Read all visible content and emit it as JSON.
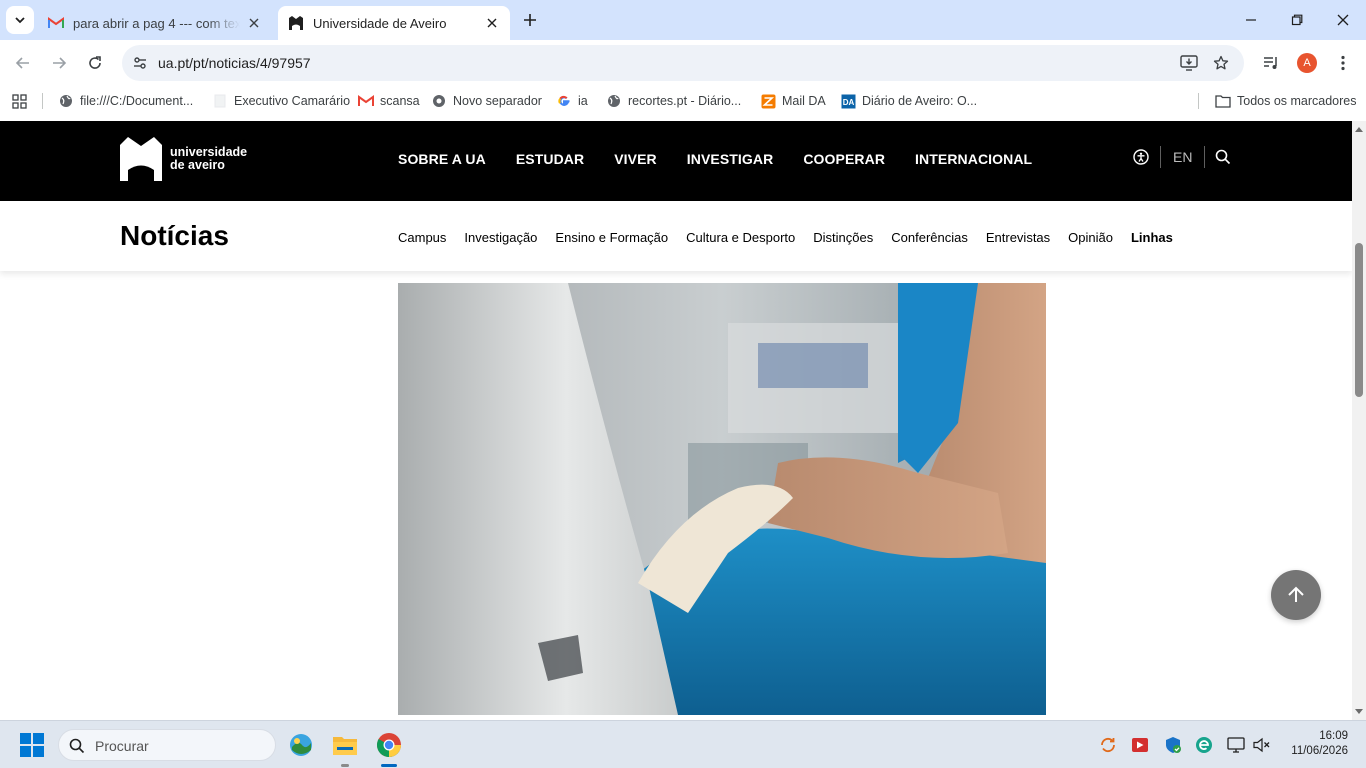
{
  "browser": {
    "tabs": [
      {
        "title": "para abrir a pag 4 --- com texto",
        "favicon": "gmail-icon"
      },
      {
        "title": "Universidade de Aveiro",
        "favicon": "ua-logo-icon"
      }
    ],
    "url": "ua.pt/pt/noticias/4/97957",
    "profile_initial": "A",
    "bookmarks": [
      {
        "label": "file:///C:/Document...",
        "icon": "globe-icon"
      },
      {
        "label": "Executivo Camarário",
        "icon": "blank-page-icon"
      },
      {
        "label": "scansa",
        "icon": "gmail-icon"
      },
      {
        "label": "Novo separador",
        "icon": "chrome-icon"
      },
      {
        "label": "ia",
        "icon": "google-icon"
      },
      {
        "label": "recortes.pt - Diário...",
        "icon": "globe-icon"
      },
      {
        "label": "Mail DA",
        "icon": "zimbra-icon"
      },
      {
        "label": "Diário de Aveiro: O...",
        "icon": "da-icon"
      }
    ],
    "all_bookmarks_label": "Todos os marcadores"
  },
  "site": {
    "logo_line1": "universidade",
    "logo_line2": "de aveiro",
    "main_nav": [
      "SOBRE A UA",
      "ESTUDAR",
      "VIVER",
      "INVESTIGAR",
      "COOPERAR",
      "INTERNACIONAL"
    ],
    "language": "EN",
    "section_title": "Notícias",
    "sub_nav": [
      "Campus",
      "Investigação",
      "Ensino e Formação",
      "Cultura e Desporto",
      "Distinções",
      "Conferências",
      "Entrevistas",
      "Opinião",
      "Linhas"
    ]
  },
  "taskbar": {
    "search_placeholder": "Procurar",
    "time": "16:09",
    "date": "11/06/2026"
  },
  "colors": {
    "tabbar": "#d3e3fd",
    "site_header": "#000000",
    "accent_blue": "#0067c0",
    "to_top_button": "#757575"
  }
}
